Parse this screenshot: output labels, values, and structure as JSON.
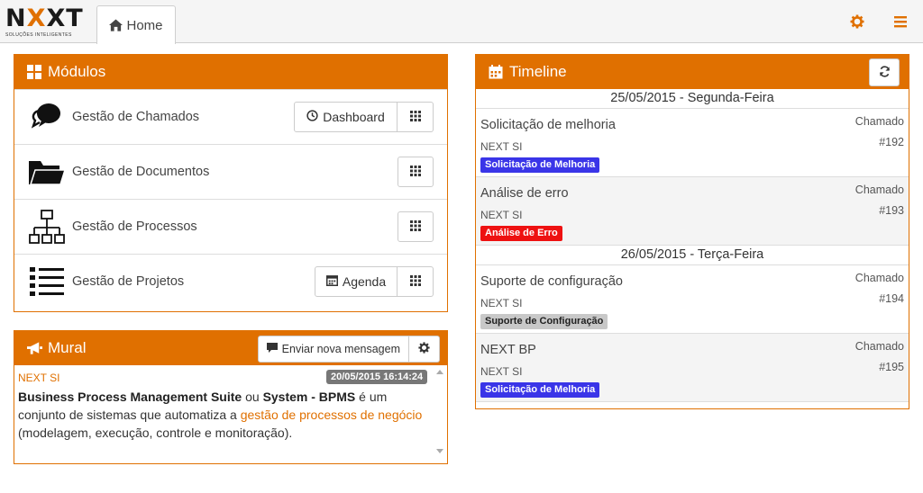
{
  "app": {
    "logo": {
      "word_left": "N",
      "word_x": "X",
      "word_right": "XT",
      "tagline": "SOLUÇÕES INTELIGENTES"
    },
    "tabs": [
      {
        "label": "Home"
      }
    ],
    "accent_color": "#e07000"
  },
  "modulos": {
    "title": "Módulos",
    "items": [
      {
        "label": "Gestão de Chamados",
        "button": "Dashboard"
      },
      {
        "label": "Gestão de Documentos"
      },
      {
        "label": "Gestão de Processos"
      },
      {
        "label": "Gestão de Projetos",
        "button": "Agenda"
      }
    ]
  },
  "mural": {
    "title": "Mural",
    "send_label": "Enviar nova mensagem",
    "message": {
      "sender": "NEXT SI",
      "date": "20/05/2015 16:14:24",
      "parts": [
        "Business Process Management Suite",
        " ou ",
        "System - BPMS",
        " é um conjunto de sistemas que automatiza a ",
        "gestão de processos de negócio",
        " (modelagem, execução, controle e monitoração)."
      ]
    }
  },
  "timeline": {
    "title": "Timeline",
    "days": [
      {
        "date": "25/05/2015 - Segunda-Feira",
        "items": [
          {
            "title": "Solicitação de melhoria",
            "org": "NEXT SI",
            "badge": "Solicitação de Melhoria",
            "badge_color": "#3a35e8",
            "kind": "Chamado",
            "number": "#192"
          },
          {
            "title": "Análise de erro",
            "org": "NEXT SI",
            "badge": "Análise de Erro",
            "badge_color": "#ee1111",
            "kind": "Chamado",
            "number": "#193"
          }
        ]
      },
      {
        "date": "26/05/2015 - Terça-Feira",
        "items": [
          {
            "title": "Suporte de configuração",
            "org": "NEXT SI",
            "badge": "Suporte de Configuração",
            "badge_color": "#c8c8c8",
            "kind": "Chamado",
            "number": "#194"
          },
          {
            "title": "NEXT BP",
            "org": "NEXT SI",
            "badge": "Solicitação de Melhoria",
            "badge_color": "#3a35e8",
            "kind": "Chamado",
            "number": "#195"
          }
        ]
      }
    ]
  }
}
